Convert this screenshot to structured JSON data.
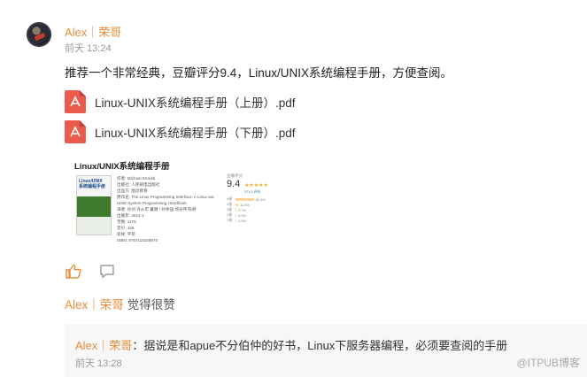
{
  "post": {
    "author": "Alex｜荣哥",
    "time": "前天 13:24",
    "text": "推荐一个非常经典，豆瓣评分9.4，Linux/UNIX系统编程手册，方便查阅。",
    "files": [
      {
        "name": "Linux-UNIX系统编程手册（上册）.pdf",
        "icon": "pdf-file-icon"
      },
      {
        "name": "Linux-UNIX系统编程手册（下册）.pdf",
        "icon": "pdf-file-icon"
      }
    ]
  },
  "book_card": {
    "title": "Linux/UNIX系统编程手册",
    "cover_text": "Linux/UNIX\n系统编程手册",
    "meta": [
      "作者: Michael Kerrisk",
      "出版社: 人民邮电出版社",
      "出品方: 图灵教育",
      "原作名: The Linux Programming Interface: A Linux and",
      "UNIX System Programming Handbook",
      "译者: 孙剑 许从年 董健 / 孙余强 郭光伟 陈舸",
      "出版年: 2014-1",
      "页数: 1176",
      "定价: 158",
      "装帧: 平装",
      "ISBN: 9787115328670"
    ],
    "rating_label": "豆瓣评分",
    "rating_score": "9.4",
    "stars": "★★★★★",
    "rating_count": "271人评价",
    "rating_bars": [
      {
        "label": "5星",
        "percent": 82.3,
        "text": "82.3%"
      },
      {
        "label": "4星",
        "percent": 11.8,
        "text": "11.8%"
      },
      {
        "label": "3星",
        "percent": 3.7,
        "text": "3.7%"
      },
      {
        "label": "2星",
        "percent": 0.0,
        "text": "0.0%"
      },
      {
        "label": "1星",
        "percent": 0.0,
        "text": "0.0%"
      }
    ]
  },
  "actions": {
    "like_icon": "thumbs-up-icon",
    "comment_icon": "comment-bubble-icon"
  },
  "likes": {
    "name": "Alex｜荣哥",
    "text": "觉得很赞"
  },
  "comment": {
    "name": "Alex｜荣哥",
    "separator": "：",
    "text": "据说是和apue不分伯仲的好书，Linux下服务器编程，必须要查阅的手册",
    "time": "前天 13:28"
  },
  "watermark": "@ITPUB博客",
  "colors": {
    "accent": "#e88d3a",
    "pdf": "#e95b4c",
    "comment_bg": "#f7f7f7"
  }
}
